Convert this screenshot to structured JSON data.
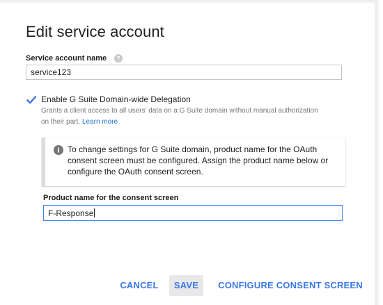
{
  "dialog": {
    "title": "Edit service account",
    "service_account": {
      "label": "Service account name",
      "help_icon": "help-circle-icon",
      "value": "service123"
    },
    "delegation": {
      "checked": true,
      "label": "Enable G Suite Domain-wide Delegation",
      "description": "Grants a client access to all users' data on a G Suite domain without manual authorization on their part.",
      "learn_more": "Learn more"
    },
    "notice": {
      "icon": "info-icon",
      "text": "To change settings for G Suite domain, product name for the OAuth consent screen must be configured. Assign the product name below or configure the OAuth consent screen."
    },
    "product_name": {
      "label": "Product name for the consent screen",
      "value": "F-Response"
    },
    "actions": {
      "cancel": "CANCEL",
      "save": "SAVE",
      "configure": "CONFIGURE CONSENT SCREEN"
    },
    "colors": {
      "accent": "#3b78e7",
      "link": "#1e73d2",
      "focus_border": "#4285f4"
    }
  }
}
